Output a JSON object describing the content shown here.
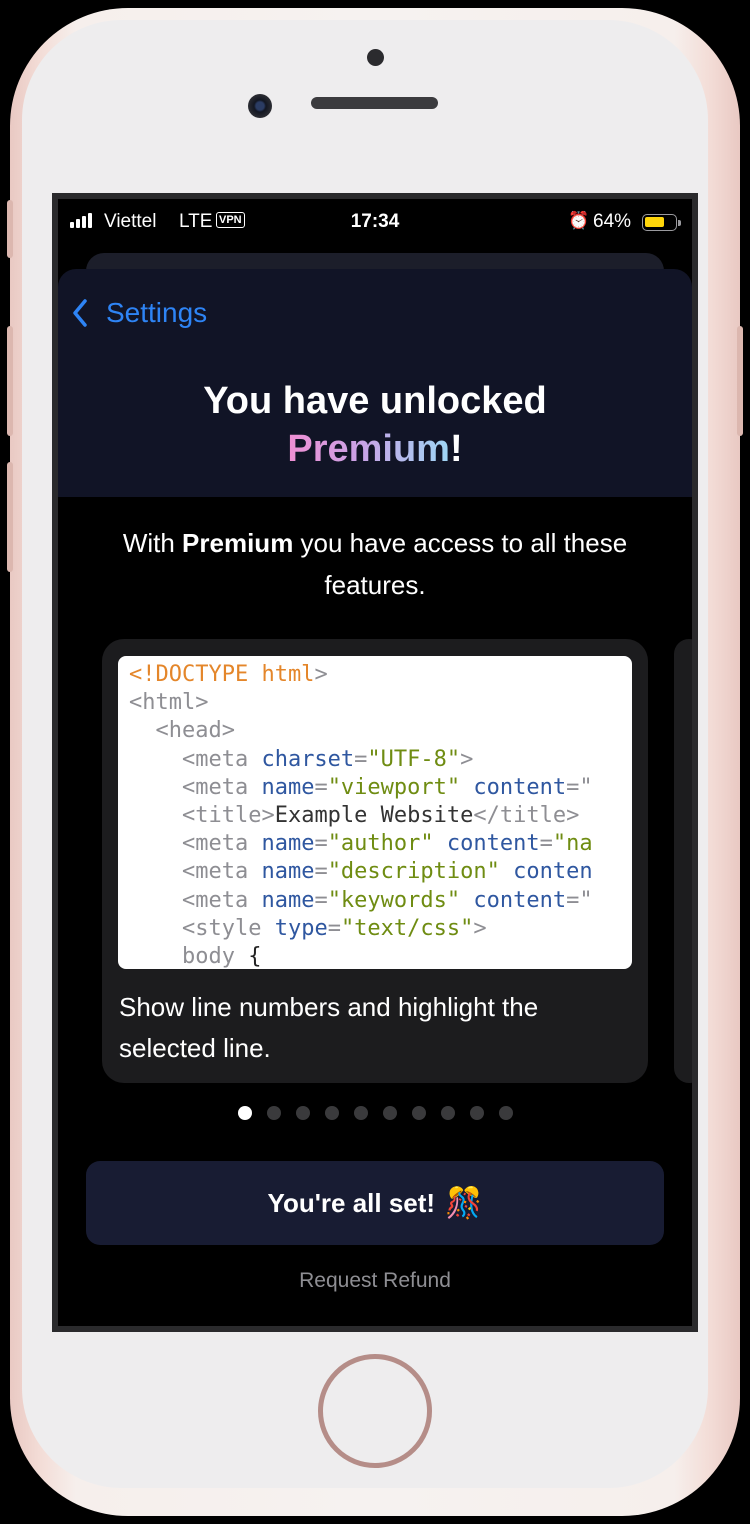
{
  "status_bar": {
    "carrier": "Viettel",
    "network": "LTE",
    "vpn": "VPN",
    "time": "17:34",
    "battery_percent": "64%",
    "battery_level": 0.64,
    "battery_color": "#ffd60a"
  },
  "nav": {
    "back_label": "Settings"
  },
  "header": {
    "title_line1": "You have unlocked",
    "title_premium": "Premium",
    "title_suffix": "!"
  },
  "subtitle": {
    "prefix": "With ",
    "bold": "Premium",
    "suffix": " you have access to all these features."
  },
  "feature": {
    "code_lines": [
      [
        {
          "t": "<!DOCTYPE html",
          "c": "doctype"
        },
        {
          "t": ">",
          "c": "tag"
        }
      ],
      [
        {
          "t": "<html>",
          "c": "tag"
        }
      ],
      [
        {
          "t": "  <head>",
          "c": "tag"
        }
      ],
      [
        {
          "t": "    <meta ",
          "c": "tag"
        },
        {
          "t": "charset",
          "c": "attr"
        },
        {
          "t": "=",
          "c": "tag"
        },
        {
          "t": "\"UTF-8\"",
          "c": "str"
        },
        {
          "t": ">",
          "c": "tag"
        }
      ],
      [
        {
          "t": "    <meta ",
          "c": "tag"
        },
        {
          "t": "name",
          "c": "attr"
        },
        {
          "t": "=",
          "c": "tag"
        },
        {
          "t": "\"viewport\"",
          "c": "str"
        },
        {
          "t": " ",
          "c": "tag"
        },
        {
          "t": "content",
          "c": "attr"
        },
        {
          "t": "=\"",
          "c": "tag"
        }
      ],
      [
        {
          "t": "    <title>",
          "c": "tag"
        },
        {
          "t": "Example Website",
          "c": "text"
        },
        {
          "t": "</title>",
          "c": "tag"
        }
      ],
      [
        {
          "t": "    <meta ",
          "c": "tag"
        },
        {
          "t": "name",
          "c": "attr"
        },
        {
          "t": "=",
          "c": "tag"
        },
        {
          "t": "\"author\"",
          "c": "str"
        },
        {
          "t": " ",
          "c": "tag"
        },
        {
          "t": "content",
          "c": "attr"
        },
        {
          "t": "=",
          "c": "tag"
        },
        {
          "t": "\"na",
          "c": "str"
        }
      ],
      [
        {
          "t": "    <meta ",
          "c": "tag"
        },
        {
          "t": "name",
          "c": "attr"
        },
        {
          "t": "=",
          "c": "tag"
        },
        {
          "t": "\"description\"",
          "c": "str"
        },
        {
          "t": " ",
          "c": "tag"
        },
        {
          "t": "conten",
          "c": "attr"
        }
      ],
      [
        {
          "t": "    <meta ",
          "c": "tag"
        },
        {
          "t": "name",
          "c": "attr"
        },
        {
          "t": "=",
          "c": "tag"
        },
        {
          "t": "\"keywords\"",
          "c": "str"
        },
        {
          "t": " ",
          "c": "tag"
        },
        {
          "t": "content",
          "c": "attr"
        },
        {
          "t": "=\"",
          "c": "tag"
        }
      ],
      [
        {
          "t": "    <style ",
          "c": "tag"
        },
        {
          "t": "type",
          "c": "attr"
        },
        {
          "t": "=",
          "c": "tag"
        },
        {
          "t": "\"text/css\"",
          "c": "str"
        },
        {
          "t": ">",
          "c": "tag"
        }
      ],
      [
        {
          "t": "    body ",
          "c": "tag"
        },
        {
          "t": "{",
          "c": "brace"
        }
      ]
    ],
    "caption": "Show line numbers and highlight the selected line."
  },
  "pagination": {
    "total": 10,
    "active_index": 0
  },
  "primary_button": {
    "label": "You're all set!",
    "icon": "party-popper-icon",
    "emoji": "🎊"
  },
  "refund_link": {
    "label": "Request Refund"
  },
  "icons": {
    "back": "chevron-left-icon",
    "alarm": "alarm-icon",
    "battery": "battery-icon",
    "signal": "cellular-signal-icon"
  },
  "colors": {
    "accent": "#2e84f5",
    "header_bg": "#111426",
    "button_bg": "#181c33"
  }
}
